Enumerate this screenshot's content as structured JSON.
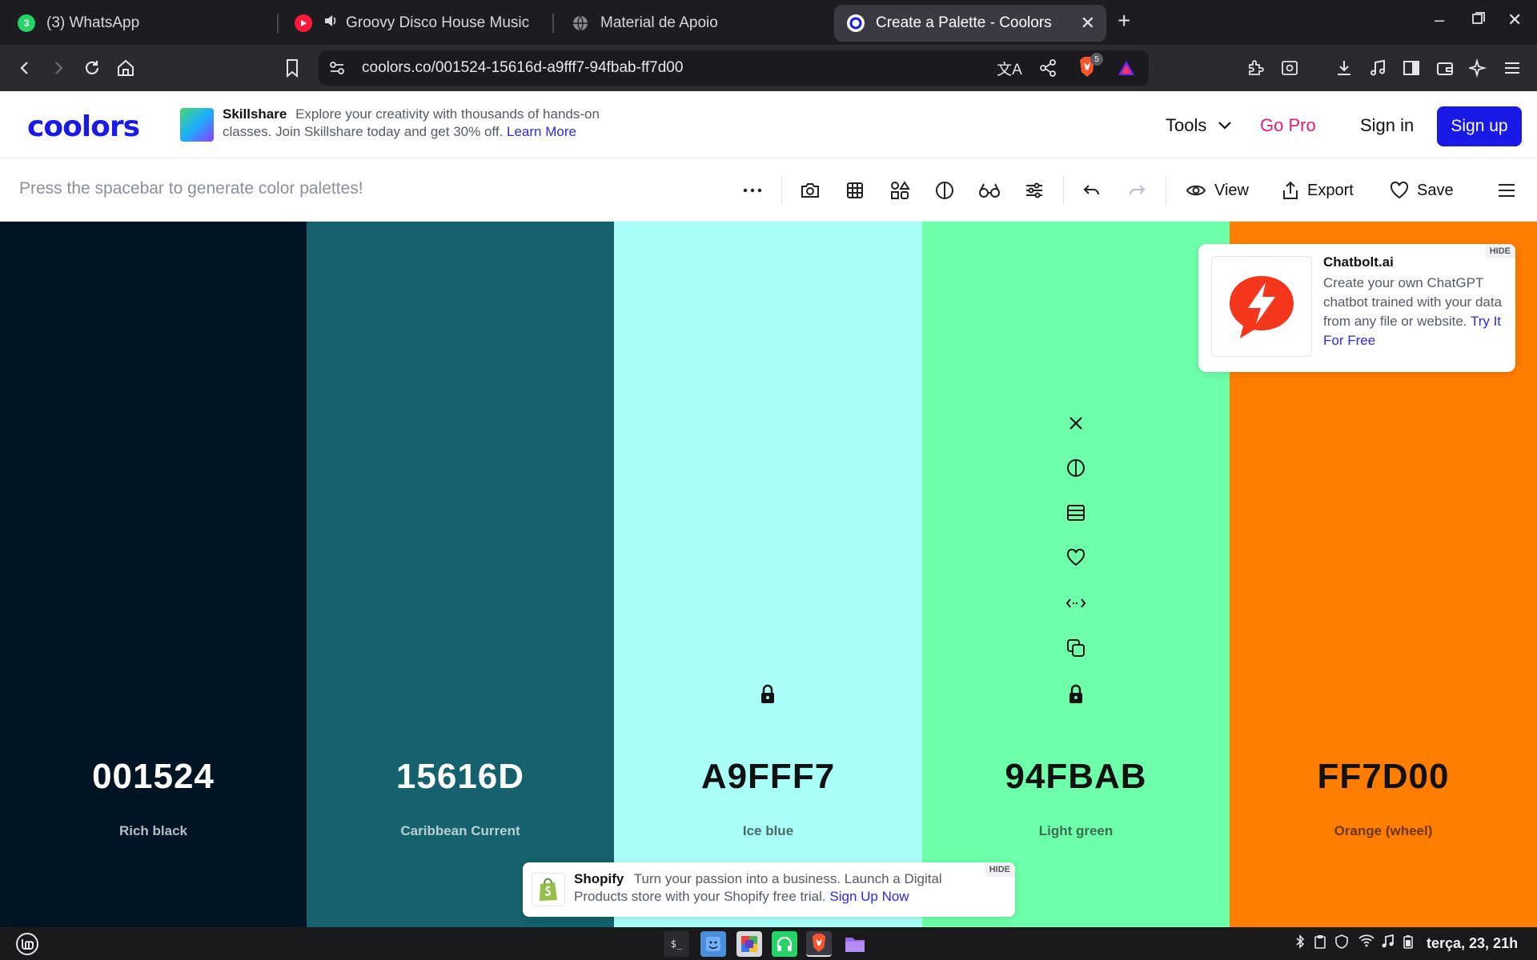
{
  "browser": {
    "tabs": [
      {
        "title": "(3) WhatsApp",
        "badge": "3"
      },
      {
        "title": "Groovy Disco House Music Mix"
      },
      {
        "title": "Material de Apoio"
      },
      {
        "title": "Create a Palette - Coolors"
      }
    ],
    "url": "coolors.co/001524-15616d-a9fff7-94fbab-ff7d00",
    "brave_badge": "5"
  },
  "header": {
    "logo": "coolors",
    "ad": {
      "brand": "Skillshare",
      "text": "Explore your creativity with thousands of hands-on classes. Join Skillshare today and get 30% off.",
      "link": "Learn More"
    },
    "nav": {
      "tools": "Tools",
      "go_pro": "Go Pro",
      "sign_in": "Sign in",
      "sign_up": "Sign up"
    }
  },
  "generator": {
    "hint": "Press the spacebar to generate color palettes!",
    "view_label": "View",
    "export_label": "Export",
    "save_label": "Save"
  },
  "palette": [
    {
      "hex": "001524",
      "name": "Rich black",
      "color": "#001524",
      "text_color": "#ffffff",
      "name_color": "#b6bcc6"
    },
    {
      "hex": "15616D",
      "name": "Caribbean Current",
      "color": "#15616d",
      "text_color": "#ffffff",
      "name_color": "#b9d0d3"
    },
    {
      "hex": "A9FFF7",
      "name": "Ice blue",
      "color": "#a9fff7",
      "text_color": "#111111",
      "name_color": "#4a6a67"
    },
    {
      "hex": "94FBAB",
      "name": "Light green",
      "color": "#6dffa9",
      "text_color": "#111111",
      "name_color": "#3e6a4d"
    },
    {
      "hex": "FF7D00",
      "name": "Orange (wheel)",
      "color": "#ff7d00",
      "text_color": "#111111",
      "name_color": "#6b3600"
    }
  ],
  "chatbolt_ad": {
    "title": "Chatbolt.ai",
    "text": "Create your own ChatGPT chatbot trained with your data from any file or website.",
    "link": "Try It For Free",
    "hide": "HIDE"
  },
  "shopify_ad": {
    "brand": "Shopify",
    "text": "Turn your passion into a business. Launch a Digital Products store with your Shopify free trial.",
    "link": "Sign Up Now",
    "hide": "HIDE"
  },
  "taskbar": {
    "clock": "terça, 23, 21h"
  }
}
